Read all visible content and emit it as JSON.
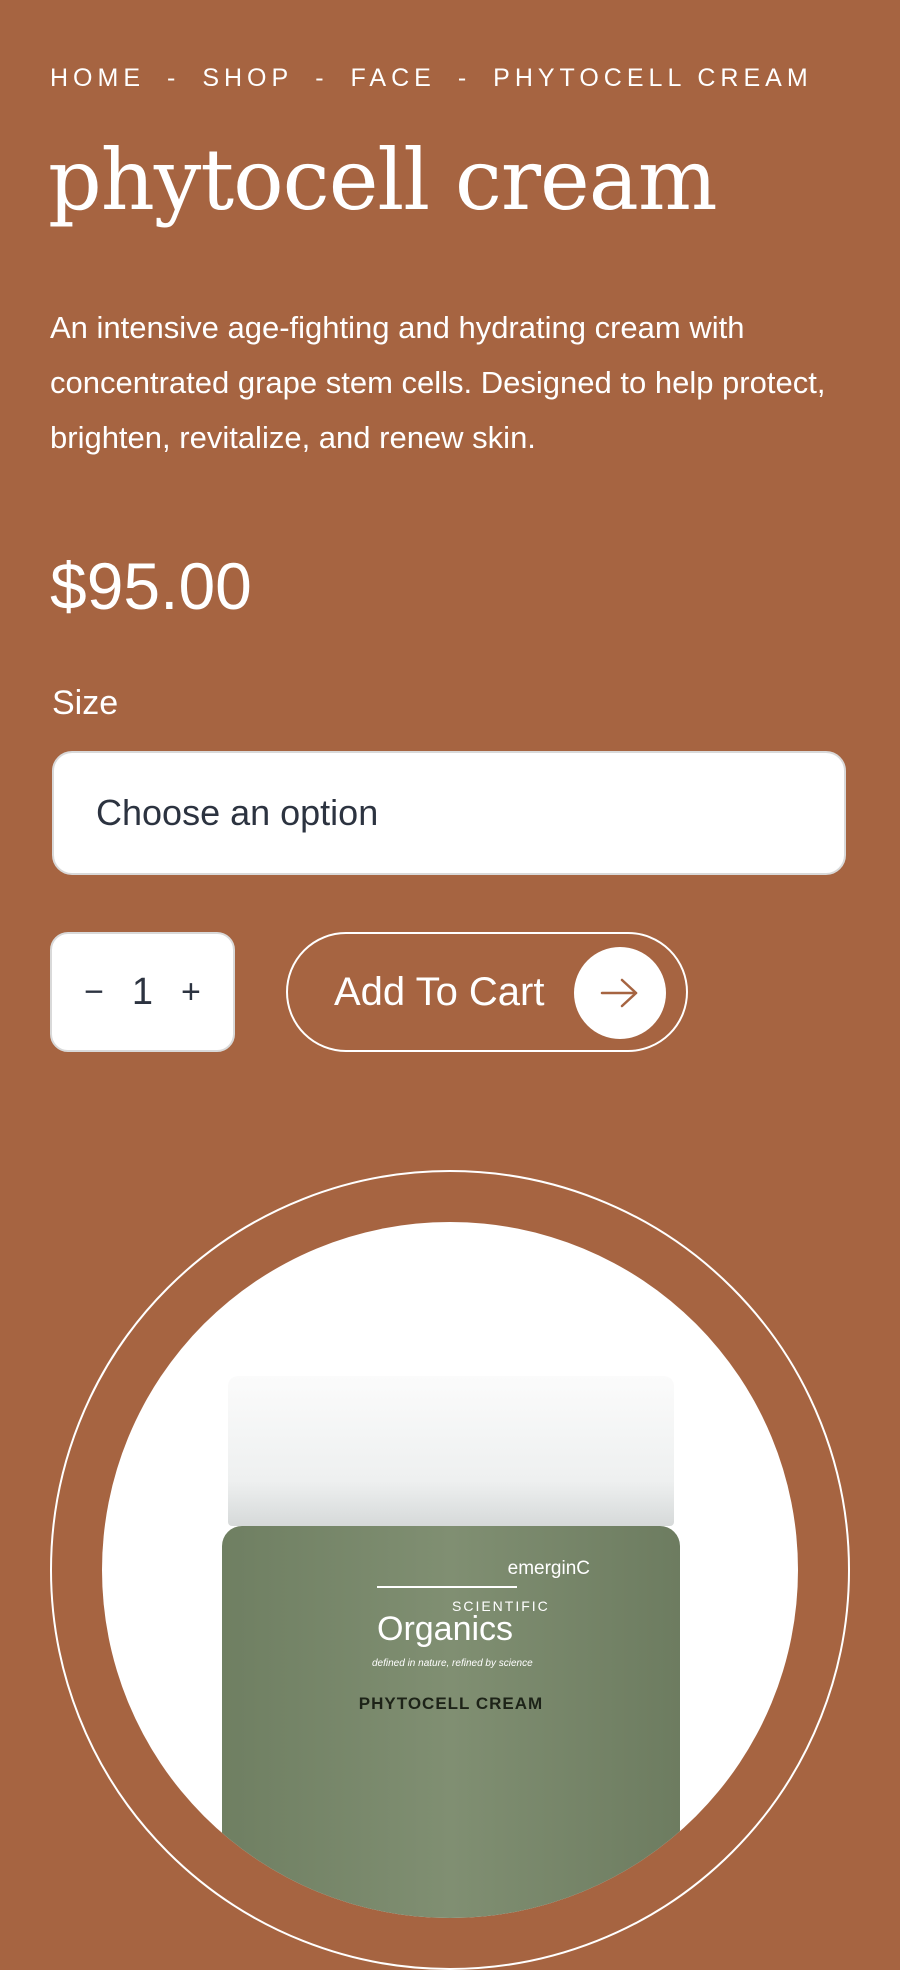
{
  "breadcrumb": {
    "items": [
      "HOME",
      "SHOP",
      "FACE",
      "PHYTOCELL CREAM"
    ],
    "separator": "-"
  },
  "product": {
    "title": "phytocell cream",
    "description": "An intensive age-fighting and hydrating cream with concentrated grape stem cells. Designed to help protect, brighten, revitalize, and renew skin.",
    "price": "$95.00"
  },
  "size": {
    "label": "Size",
    "selected": "Choose an option"
  },
  "quantity": {
    "decrement": "−",
    "value": "1",
    "increment": "+"
  },
  "cart": {
    "label": "Add To Cart",
    "icon": "arrow-right-icon"
  },
  "image": {
    "brand_top": "emerginC",
    "brand_scientific": "SCIENTIFIC",
    "brand_organics": "Organics",
    "tagline": "defined in nature, refined by science",
    "product_name": "PHYTOCELL CREAM"
  },
  "colors": {
    "background": "#a66441",
    "text": "#ffffff",
    "field_text": "#2c3340",
    "jar_green": "#7a8a6c"
  }
}
